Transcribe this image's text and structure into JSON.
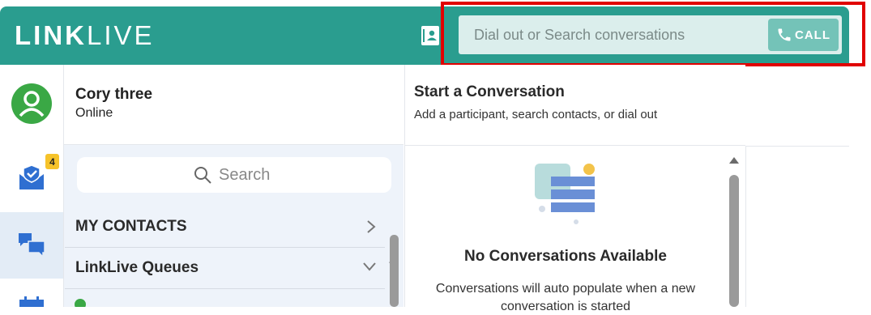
{
  "colors": {
    "brand": "#2a9d8f",
    "call_button": "#74c3b8",
    "highlight": "#e10000",
    "presence_online": "#3aa845",
    "badge": "#f6c32a",
    "accent_blue": "#2f6fd1"
  },
  "header": {
    "logo_bold": "LINK",
    "logo_light": "LIVE",
    "dial_placeholder": "Dial out or Search conversations",
    "call_label": "CALL",
    "call_icon": "phone-icon",
    "contact_icon": "contact-card-icon"
  },
  "rail": {
    "items": [
      {
        "icon": "user-avatar-icon"
      },
      {
        "icon": "envelope-check-icon",
        "badge": "4"
      },
      {
        "icon": "chat-bubbles-icon",
        "active": true
      },
      {
        "icon": "calendar-icon"
      }
    ]
  },
  "profile": {
    "name": "Cory three",
    "status": "Online"
  },
  "contacts": {
    "search_placeholder": "Search",
    "sections": [
      {
        "label": "MY CONTACTS",
        "chevron": "chevron-right-icon"
      },
      {
        "label": "LinkLive Queues",
        "chevron": "chevron-down-icon"
      }
    ]
  },
  "conversation": {
    "title": "Start a Conversation",
    "subtitle": "Add a participant, search contacts, or dial out",
    "empty_title": "No Conversations Available",
    "empty_desc": "Conversations will auto populate when a new conversation is started"
  }
}
